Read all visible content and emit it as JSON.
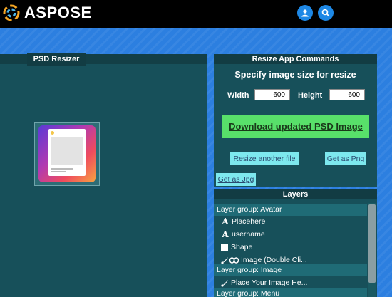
{
  "header": {
    "logo_text": "ASPOSE"
  },
  "left": {
    "title": "PSD Resizer"
  },
  "commands": {
    "title": "Resize App Commands",
    "specify": "Specify image size for resize",
    "width_label": "Width",
    "width_value": "600",
    "height_label": "Height",
    "height_value": "600",
    "download": "Download updated PSD Image",
    "resize_another": "Resize another file",
    "get_png": "Get as Png",
    "get_jpg": "Get as Jpg"
  },
  "layers": {
    "title": "Layers",
    "rows": [
      {
        "type": "group",
        "label": "Layer group: Avatar"
      },
      {
        "type": "item",
        "icon": "text-icon",
        "label": "Placehere"
      },
      {
        "type": "item",
        "icon": "text-icon",
        "label": "username"
      },
      {
        "type": "item",
        "icon": "shape-icon",
        "label": "Shape"
      },
      {
        "type": "item",
        "icon": "brush-mask-icon",
        "label": "Image (Double Cli..."
      },
      {
        "type": "group",
        "label": "Layer group: Image"
      },
      {
        "type": "item",
        "icon": "brush-icon",
        "label": "Place Your Image He..."
      },
      {
        "type": "group",
        "label": "Layer group: Menu"
      }
    ]
  }
}
